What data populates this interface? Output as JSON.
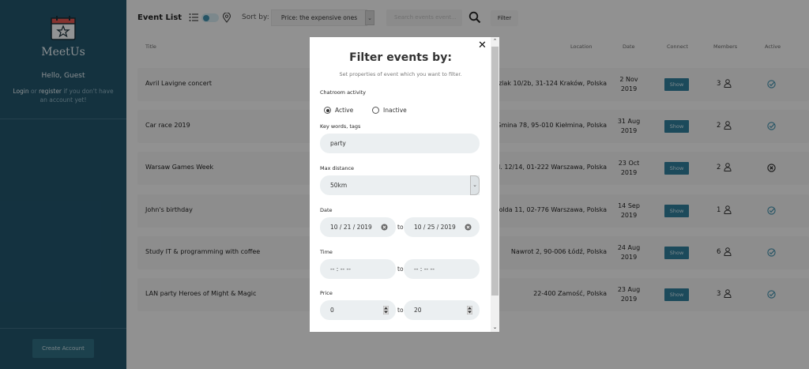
{
  "sidebar": {
    "brand": "MeetUs",
    "greeting": "Hello, Guest",
    "login_link": "Login",
    "or_text": " or ",
    "register_link": "register",
    "login_suffix": " if you don't have an account yet!",
    "create_account": "Create Account"
  },
  "toolbar": {
    "title": "Event List",
    "sort_label": "Sort by:",
    "sort_value": "Price: the expensive ones",
    "search_placeholder": "Search events event...",
    "filter_button": "Filter"
  },
  "table": {
    "headers": {
      "title": "Title",
      "location": "Location",
      "date": "Date",
      "connect": "Connect",
      "members": "Members",
      "active": "Active"
    },
    "show_label": "Show",
    "rows": [
      {
        "title": "Avril Lavigne concert",
        "location": "Szlak 10/2b, 31-124 Kraków, Polska",
        "date_line1": "2 Nov",
        "date_line2": "2019",
        "members": "3",
        "active": "check"
      },
      {
        "title": "Car race 2019",
        "location": "Gmina 78, 95-010 Kiełmina, Polska",
        "date_line1": "31 Aug",
        "date_line2": "2019",
        "members": "2",
        "active": "check"
      },
      {
        "title": "Warsaw Games Week",
        "location": "ul. 12/14, 01-222 Warszawa, Polska",
        "date_line1": "23 Oct",
        "date_line2": "2019",
        "members": "2",
        "active": "cross"
      },
      {
        "title": "John's birthday",
        "location": "Wolda 11, 02-776 Warszawa, Polska",
        "date_line1": "14 Sep",
        "date_line2": "2019",
        "members": "1",
        "active": "check"
      },
      {
        "title": "Study IT & programming with coffee",
        "location": "Nawrot 2, 90-006 Łódź, Polska",
        "date_line1": "24 Aug",
        "date_line2": "2019",
        "members": "6",
        "active": "check"
      },
      {
        "title": "LAN party Heroes of Might & Magic",
        "location": "22-400 Zamość, Polska",
        "date_line1": "23 Aug",
        "date_line2": "2019",
        "members": "3",
        "active": "check"
      }
    ]
  },
  "modal": {
    "title": "Filter events by:",
    "subtitle": "Set properties of event which you want to filter.",
    "chatroom_label": "Chatroom activity",
    "radio_active": "Active",
    "radio_inactive": "Inactive",
    "selected_activity": "Active",
    "keywords_label": "Key words, tags",
    "keywords_value": "party",
    "distance_label": "Max distance",
    "distance_value": "50km",
    "date_label": "Date",
    "date_from": "10 / 21 / 2019",
    "date_to": "10 / 25 / 2019",
    "to_label": "to",
    "time_label": "Time",
    "time_from": "-- : --  --",
    "time_to": "-- : --  --",
    "price_label": "Price",
    "price_from": "0",
    "price_to": "20"
  },
  "colors": {
    "sidebar": "#22546a",
    "accent": "#2f7c98",
    "check": "#3e8ca8"
  }
}
